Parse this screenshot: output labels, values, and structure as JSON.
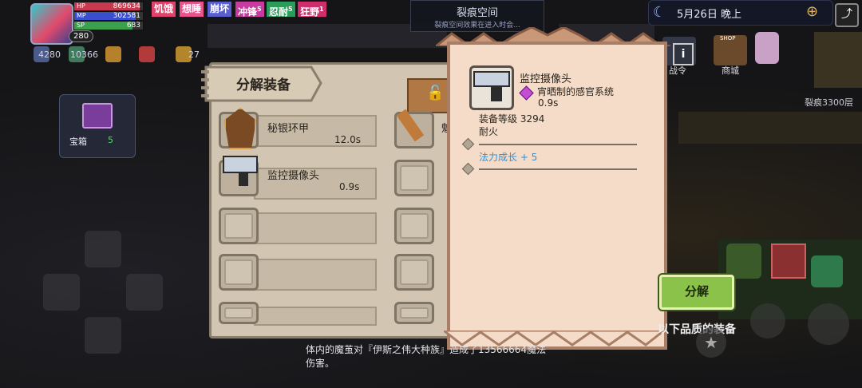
{
  "hud": {
    "level": "280",
    "hp_label": "HP",
    "hp_value": "869634",
    "hp_fill": 0.95,
    "mp_label": "MP",
    "mp_value": "302581",
    "mp_fill": 0.9,
    "sp_label": "SP",
    "sp_value": "683",
    "sp_fill": 0.85,
    "status_tags": [
      {
        "label": "饥饿",
        "color": "#e0436a"
      },
      {
        "label": "想睡",
        "color": "#e7538a"
      },
      {
        "label": "崩坏",
        "color": "#5a5fd0"
      },
      {
        "label": "冲锋",
        "color": "#c73a9e",
        "sup": "5"
      },
      {
        "label": "忍耐",
        "color": "#2c9c5a",
        "sup": "5"
      },
      {
        "label": "狂野",
        "color": "#cc2f6b",
        "sup": "1"
      }
    ],
    "stats": [
      "4280",
      "10366",
      "27"
    ]
  },
  "rift": {
    "title": "裂痕空间",
    "subtitle": "裂痕空间效果在进入时会..."
  },
  "datetime": {
    "date": "5月26日",
    "period": "晚上"
  },
  "right_menu": {
    "battle_label": "战令",
    "shop_label": "商城",
    "shop_sign": "SHOP",
    "partial_label": "闻"
  },
  "floor_label": "裂痕3300层",
  "chest": {
    "label": "宝箱",
    "count": "5"
  },
  "panel": {
    "title": "分解装备",
    "items": [
      {
        "name": "秘银环甲",
        "time": "12.0s"
      },
      {
        "name": "监控摄像头",
        "time": "0.9s"
      }
    ],
    "right_partial_label": "魁"
  },
  "tooltip": {
    "name": "监控摄像头",
    "sub_item": "宵晒制的感官系统",
    "sub_time": "0.9s",
    "level_text": "装备等级 3294",
    "attr": "耐火",
    "bonus": "法力成长 + 5"
  },
  "actions": {
    "decompose_label": "分解",
    "below_quality_label": "以下品质的装备"
  },
  "message": {
    "line1": "体内的魔茧对『伊斯之伟大种族』造成了13566664魔法",
    "line2": "伤害。"
  },
  "colors": {
    "accent_green": "#8bc34a",
    "panel_bg": "#d2c6b3",
    "scroll_bg": "#f5dcc8",
    "bonus_blue": "#2e8fd6"
  }
}
